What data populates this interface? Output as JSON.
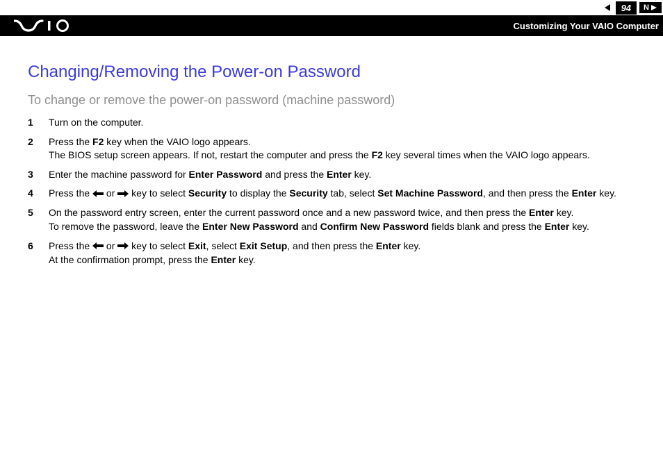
{
  "nav": {
    "page_number": "94",
    "n_label": "N"
  },
  "header": {
    "breadcrumb": "Customizing Your VAIO Computer"
  },
  "content": {
    "heading": "Changing/Removing the Power-on Password",
    "subheading": "To change or remove the power-on password (machine password)",
    "steps": [
      {
        "num": "1",
        "parts": [
          {
            "t": "Turn on the computer."
          }
        ]
      },
      {
        "num": "2",
        "parts": [
          {
            "t": "Press the "
          },
          {
            "b": "F2"
          },
          {
            "t": " key when the VAIO logo appears."
          },
          {
            "br": true
          },
          {
            "t": "The BIOS setup screen appears. If not, restart the computer and press the "
          },
          {
            "b": "F2"
          },
          {
            "t": " key several times when the VAIO logo appears."
          }
        ]
      },
      {
        "num": "3",
        "parts": [
          {
            "t": "Enter the machine password for "
          },
          {
            "b": "Enter Password"
          },
          {
            "t": " and press the "
          },
          {
            "b": "Enter"
          },
          {
            "t": " key."
          }
        ]
      },
      {
        "num": "4",
        "parts": [
          {
            "t": "Press the "
          },
          {
            "arrow": "left"
          },
          {
            "t": " or "
          },
          {
            "arrow": "right"
          },
          {
            "t": " key to select "
          },
          {
            "b": "Security"
          },
          {
            "t": " to display the "
          },
          {
            "b": "Security"
          },
          {
            "t": " tab, select "
          },
          {
            "b": "Set Machine Password"
          },
          {
            "t": ", and then press the "
          },
          {
            "b": "Enter"
          },
          {
            "t": " key."
          }
        ]
      },
      {
        "num": "5",
        "parts": [
          {
            "t": "On the password entry screen, enter the current password once and a new password twice, and then press the "
          },
          {
            "b": "Enter"
          },
          {
            "t": " key."
          },
          {
            "br": true
          },
          {
            "t": "To remove the password, leave the "
          },
          {
            "b": "Enter New Password"
          },
          {
            "t": " and "
          },
          {
            "b": "Confirm New Password"
          },
          {
            "t": " fields blank and press the "
          },
          {
            "b": "Enter"
          },
          {
            "t": " key."
          }
        ]
      },
      {
        "num": "6",
        "parts": [
          {
            "t": "Press the "
          },
          {
            "arrow": "left"
          },
          {
            "t": " or "
          },
          {
            "arrow": "right"
          },
          {
            "t": " key to select "
          },
          {
            "b": "Exit"
          },
          {
            "t": ", select "
          },
          {
            "b": "Exit Setup"
          },
          {
            "t": ", and then press the "
          },
          {
            "b": "Enter"
          },
          {
            "t": " key."
          },
          {
            "br": true
          },
          {
            "t": "At the confirmation prompt, press the "
          },
          {
            "b": "Enter"
          },
          {
            "t": " key."
          }
        ]
      }
    ]
  }
}
